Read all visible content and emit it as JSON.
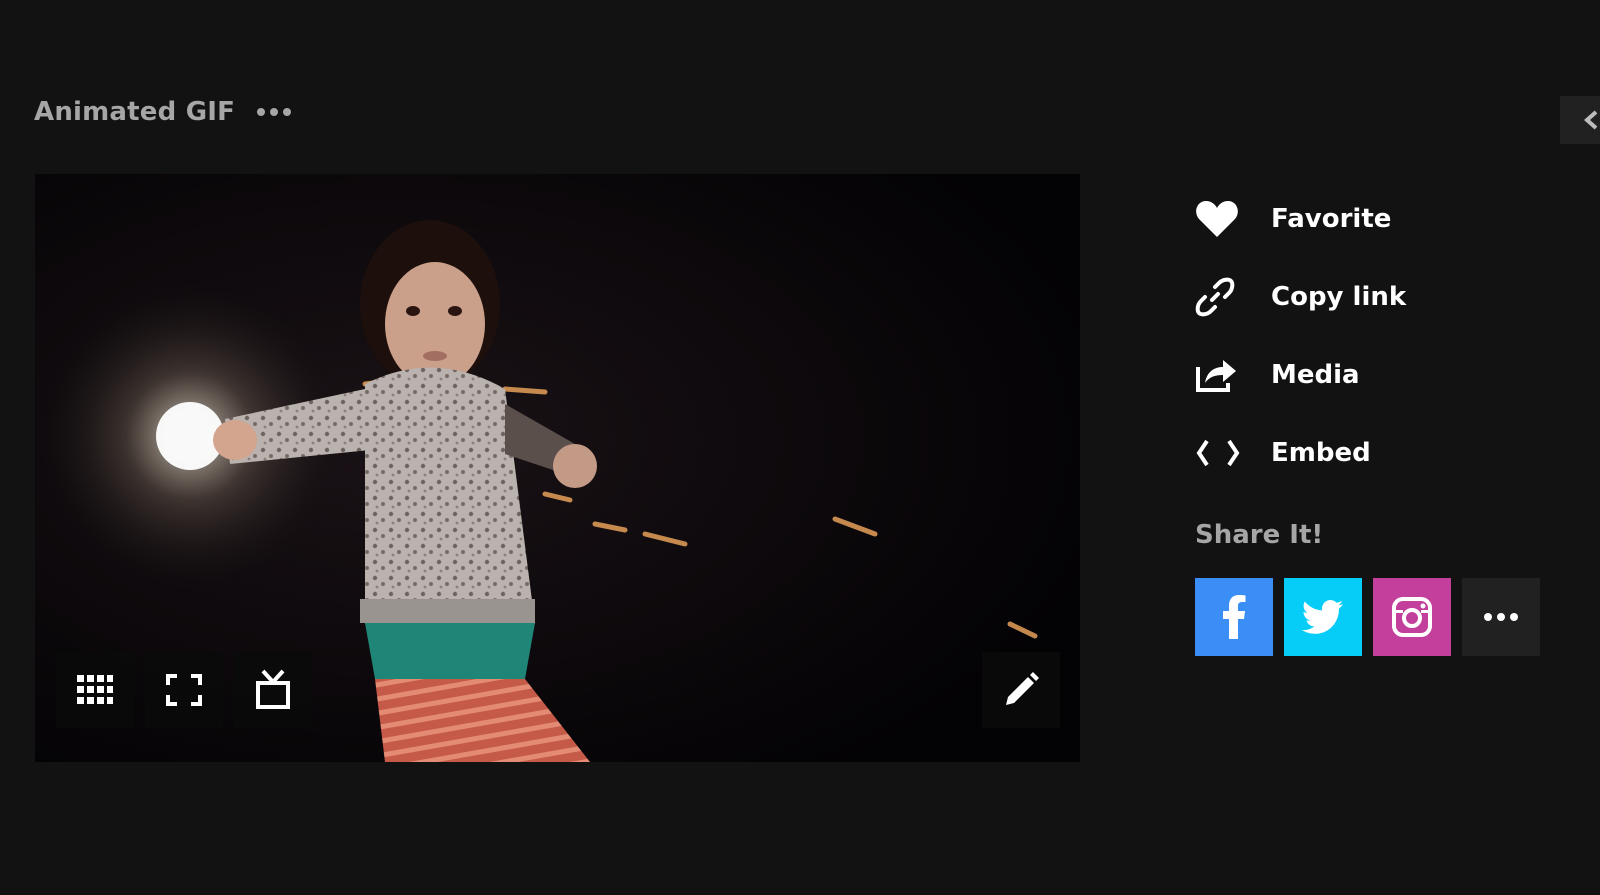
{
  "header": {
    "title": "Animated GIF",
    "more_icon": "more-dots-icon"
  },
  "media": {
    "controls": [
      {
        "name": "grid-view-icon"
      },
      {
        "name": "fullscreen-icon"
      },
      {
        "name": "tv-icon"
      },
      {
        "name": "edit-pencil-icon"
      }
    ]
  },
  "actions": [
    {
      "label": "Favorite",
      "icon": "heart-icon"
    },
    {
      "label": "Copy link",
      "icon": "link-icon"
    },
    {
      "label": "Media",
      "icon": "share-arrow-icon"
    },
    {
      "label": "Embed",
      "icon": "code-brackets-icon"
    }
  ],
  "share": {
    "title": "Share It!",
    "buttons": [
      {
        "icon": "facebook-icon",
        "color": "#3b8ef6"
      },
      {
        "icon": "twitter-icon",
        "color": "#06ccf8"
      },
      {
        "icon": "instagram-icon",
        "color": "#c2409b"
      },
      {
        "icon": "more-dots-icon",
        "color": "#212121"
      }
    ]
  },
  "colors": {
    "background": "#121212",
    "text_primary": "#ffffff",
    "text_secondary": "#a6a6a6"
  }
}
